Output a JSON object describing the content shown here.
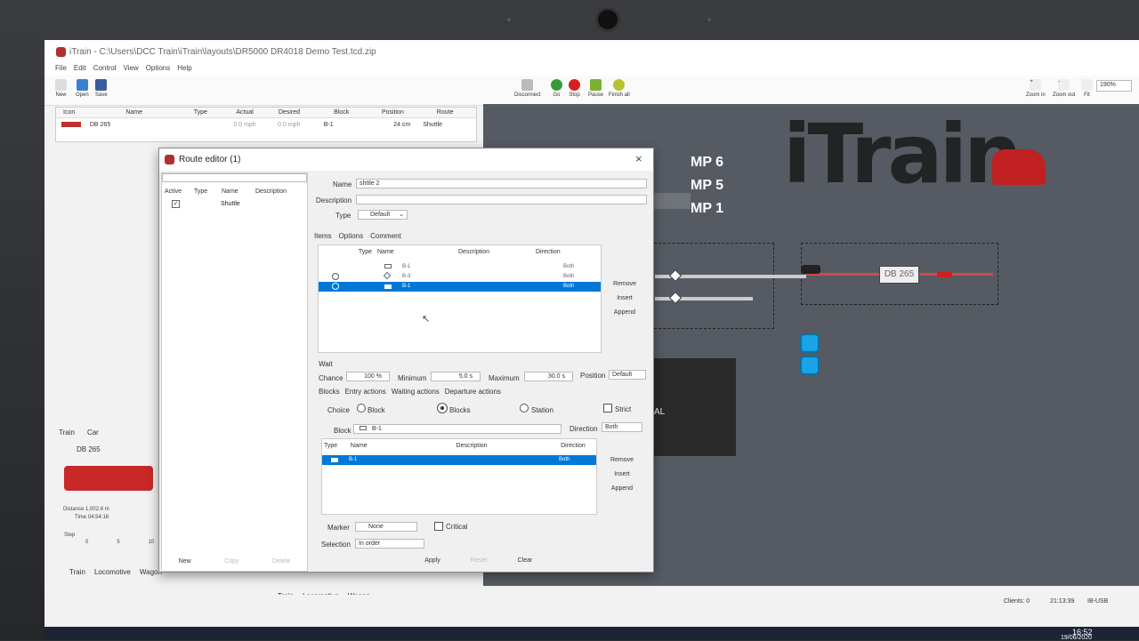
{
  "window_title": "iTrain - C:\\Users\\DCC Train\\iTrain\\layouts\\DR5000 DR4018 Demo Test.tcd.zip",
  "menu": [
    "File",
    "Edit",
    "Control",
    "View",
    "Options",
    "Help"
  ],
  "toolbar": {
    "new": "New",
    "open": "Open",
    "save": "Save",
    "disconnect": "Disconnect",
    "go": "Go",
    "stop": "Stop",
    "pause": "Pause",
    "finish_all": "Finish all",
    "zoom_in": "Zoom in",
    "zoom_out": "Zoom out",
    "fit": "Fit",
    "zoom_level": "190%"
  },
  "train_table": {
    "headers": [
      "Icon",
      "Name",
      "Type",
      "Actual",
      "Desired",
      "Block",
      "Position",
      "Route"
    ],
    "row": {
      "name": "DB 265",
      "actual": "0.0 mph",
      "desired": "0.0 mph",
      "block": "B-1",
      "position": "24 cm",
      "route": "Shuttle"
    }
  },
  "left_panel": {
    "tabs": [
      "Train",
      "Car"
    ],
    "train_name": "DB 265",
    "distance": "Distance  1,002.6 m",
    "time": "Time  04:54:16",
    "step_label": "Step",
    "scale": [
      "0",
      "5",
      "10"
    ],
    "bottom_tabs": [
      "Train",
      "Locomotive",
      "Wagon"
    ]
  },
  "canvas": {
    "logo": "iTrain",
    "mp": [
      "MP 6",
      "MP 5",
      "MP 1"
    ],
    "loco_label": "DB 265",
    "panel_text": "AL"
  },
  "dialog": {
    "title": "Route editor (1)",
    "list_headers": [
      "Active",
      "Type",
      "Name",
      "Description"
    ],
    "list_row": {
      "name": "Shuttle"
    },
    "name_label": "Name",
    "name_value": "shttle 2",
    "description_label": "Description",
    "type_label": "Type",
    "type_value": "Default",
    "tabs": [
      "Items",
      "Options",
      "Comment"
    ],
    "items_headers": [
      "Type",
      "Name",
      "Description",
      "Direction"
    ],
    "items": [
      {
        "name": "B-1",
        "direction": "Both"
      },
      {
        "name": "B-3",
        "direction": "Both"
      },
      {
        "name": "B-1",
        "direction": "Both"
      }
    ],
    "item_buttons": [
      "Remove",
      "Insert",
      "Append"
    ],
    "wait_label": "Wait",
    "chance_label": "Chance",
    "chance_value": "100 %",
    "minimum_label": "Minimum",
    "minimum_value": "5.0 s",
    "maximum_label": "Maximum",
    "maximum_value": "30.0 s",
    "position_label": "Position",
    "position_value": "Default",
    "sub_tabs": [
      "Blocks",
      "Entry actions",
      "Waiting actions",
      "Departure actions"
    ],
    "choice_label": "Choice",
    "choice_options": [
      "Block",
      "Blocks",
      "Station"
    ],
    "strict_label": "Strict",
    "block_label": "Block",
    "block_value": "B-1",
    "direction_label": "Direction",
    "direction_value": "Both",
    "blocks_headers": [
      "Type",
      "Name",
      "Description",
      "Direction"
    ],
    "blocks_row": {
      "name": "B-1",
      "direction": "Both"
    },
    "block_buttons": [
      "Remove",
      "Insert",
      "Append"
    ],
    "marker_label": "Marker",
    "marker_value": "None",
    "critical_label": "Critical",
    "selection_label": "Selection",
    "selection_value": "In order",
    "bottom_buttons": [
      "Apply",
      "Reset",
      "Clear"
    ],
    "list_buttons": [
      "New",
      "Copy",
      "Delete"
    ],
    "below_tabs": [
      "Train",
      "Locomotive",
      "Wagon"
    ]
  },
  "status": {
    "clients": "Clients: 0",
    "time": "21:13:39",
    "device": "IB-USB"
  },
  "taskbar": {
    "time": "16:52",
    "date": "19/06/2020"
  }
}
